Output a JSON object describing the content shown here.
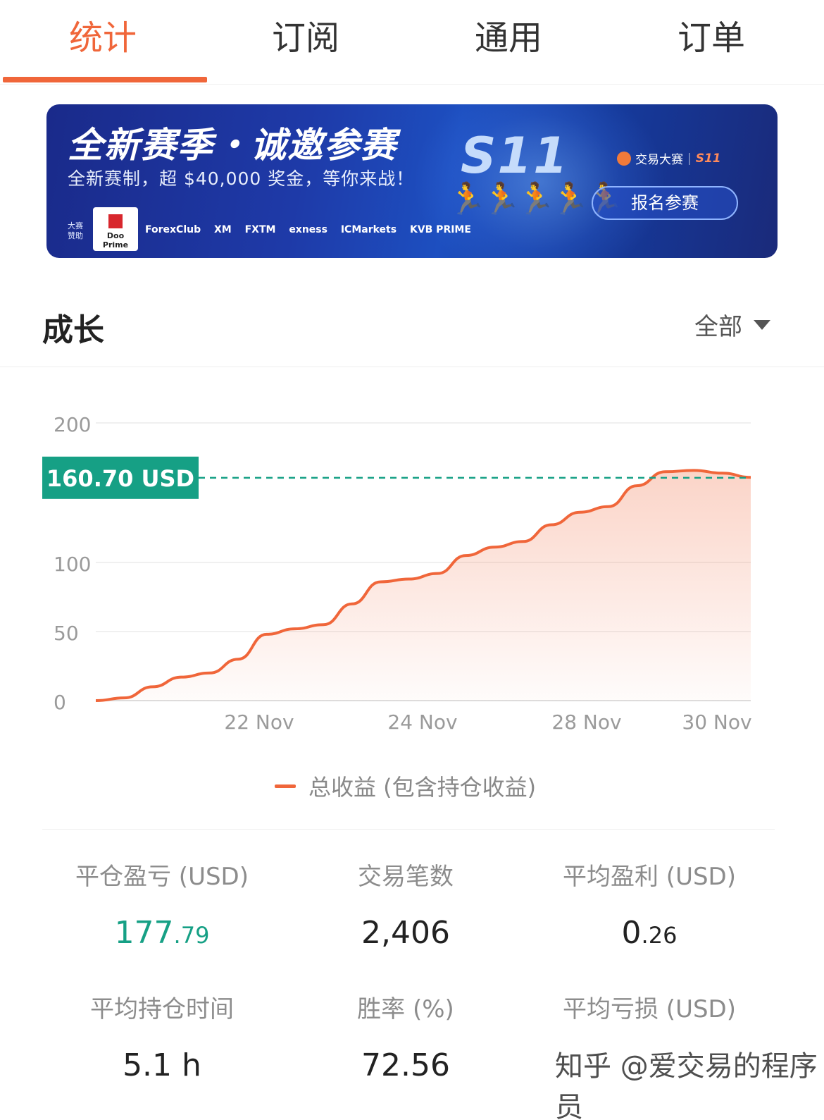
{
  "tabs": [
    {
      "label": "统计",
      "active": true
    },
    {
      "label": "订阅",
      "active": false
    },
    {
      "label": "通用",
      "active": false
    },
    {
      "label": "订单",
      "active": false
    }
  ],
  "banner": {
    "title": "全新赛季・诚邀参赛",
    "subtitle": "全新赛制，超 $40,000 奖金，等你来战！",
    "season": "S11",
    "brand_name": "交易大赛",
    "brand_season": "S11",
    "cta": "报名参赛",
    "sponsor_label": "大赛赞助",
    "sponsors": [
      "Doo Prime",
      "ForexClub",
      "XM",
      "FXTM",
      "exness",
      "ICMarkets",
      "KVB PRIME"
    ]
  },
  "growth": {
    "title": "成长",
    "range": "全部"
  },
  "chart_data": {
    "type": "area",
    "x_ticks": [
      "22 Nov",
      "24 Nov",
      "28 Nov",
      "30 Nov"
    ],
    "y_ticks": [
      0,
      50,
      100,
      200
    ],
    "ylim": [
      0,
      200
    ],
    "current_label": "160.70 USD",
    "current_value": 160.7,
    "series": [
      {
        "name": "总收益 (包含持仓收益)",
        "color": "#f0663a",
        "values": [
          0,
          2,
          10,
          17,
          20,
          30,
          48,
          52,
          55,
          70,
          86,
          88,
          92,
          105,
          111,
          115,
          127,
          136,
          140,
          155,
          165,
          166,
          164,
          161
        ]
      }
    ],
    "legend": "总收益 (包含持仓收益)",
    "colors": {
      "line": "#f0663a",
      "marker": "#16a085"
    }
  },
  "stats": [
    {
      "label": "平仓盈亏 (USD)",
      "int": "177",
      "dec": ".79",
      "green": true
    },
    {
      "label": "交易笔数",
      "int": "2,406",
      "dec": "",
      "green": false
    },
    {
      "label": "平均盈利 (USD)",
      "int": "0",
      "dec": ".26",
      "green": false
    },
    {
      "label": "平均持仓时间",
      "int": "5.1 h",
      "dec": "",
      "green": false
    },
    {
      "label": "胜率 (%)",
      "int": "72.56",
      "dec": "",
      "green": false
    },
    {
      "label": "平均亏损 (USD)",
      "int": "",
      "dec": "",
      "green": false
    }
  ],
  "watermark": "知乎 @爱交易的程序员"
}
